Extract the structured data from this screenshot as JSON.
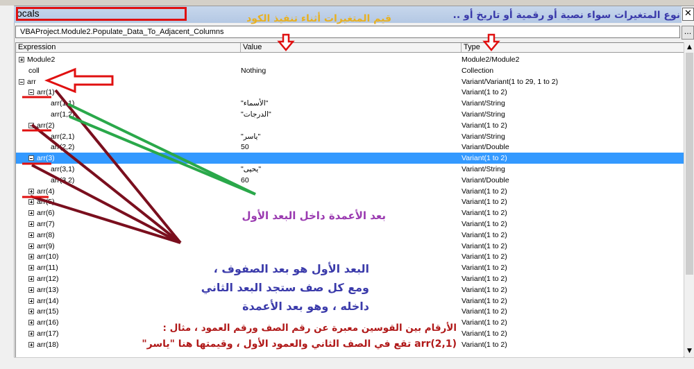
{
  "window": {
    "title": "ocals",
    "close_glyph": "✕"
  },
  "context": {
    "value": "VBAProject.Module2.Populate_Data_To_Adjacent_Columns",
    "button_glyph": "..."
  },
  "columns": {
    "expression": "Expression",
    "value": "Value",
    "type": "Type"
  },
  "rows": [
    {
      "expr": "Module2",
      "val": "",
      "type": "Module2/Module2"
    },
    {
      "expr": "coll",
      "val": "Nothing",
      "type": "Collection"
    },
    {
      "expr": "arr",
      "val": "",
      "type": "Variant/Variant(1 to 29, 1 to 2)"
    },
    {
      "expr": "arr(1)",
      "val": "",
      "type": "Variant(1 to 2)"
    },
    {
      "expr": "arr(1,1)",
      "val": "\"الأسماء\"",
      "type": "Variant/String"
    },
    {
      "expr": "arr(1,2)",
      "val": "\"الدرجات\"",
      "type": "Variant/String"
    },
    {
      "expr": "arr(2)",
      "val": "",
      "type": "Variant(1 to 2)"
    },
    {
      "expr": "arr(2,1)",
      "val": "\"ياسر\"",
      "type": "Variant/String"
    },
    {
      "expr": "arr(2,2)",
      "val": "50",
      "type": "Variant/Double"
    },
    {
      "expr": "arr(3)",
      "val": "",
      "type": "Variant(1 to 2)"
    },
    {
      "expr": "arr(3,1)",
      "val": "\"يحيى\"",
      "type": "Variant/String"
    },
    {
      "expr": "arr(3,2)",
      "val": "60",
      "type": "Variant/Double"
    },
    {
      "expr": "arr(4)",
      "val": "",
      "type": "Variant(1 to 2)"
    },
    {
      "expr": "arr(5)",
      "val": "",
      "type": "Variant(1 to 2)"
    },
    {
      "expr": "arr(6)",
      "val": "",
      "type": "Variant(1 to 2)"
    },
    {
      "expr": "arr(7)",
      "val": "",
      "type": "Variant(1 to 2)"
    },
    {
      "expr": "arr(8)",
      "val": "",
      "type": "Variant(1 to 2)"
    },
    {
      "expr": "arr(9)",
      "val": "",
      "type": "Variant(1 to 2)"
    },
    {
      "expr": "arr(10)",
      "val": "",
      "type": "Variant(1 to 2)"
    },
    {
      "expr": "arr(11)",
      "val": "",
      "type": "Variant(1 to 2)"
    },
    {
      "expr": "arr(12)",
      "val": "",
      "type": "Variant(1 to 2)"
    },
    {
      "expr": "arr(13)",
      "val": "",
      "type": "Variant(1 to 2)"
    },
    {
      "expr": "arr(14)",
      "val": "",
      "type": "Variant(1 to 2)"
    },
    {
      "expr": "arr(15)",
      "val": "",
      "type": "Variant(1 to 2)"
    },
    {
      "expr": "arr(16)",
      "val": "",
      "type": "Variant(1 to 2)"
    },
    {
      "expr": "arr(17)",
      "val": "",
      "type": "Variant(1 to 2)"
    },
    {
      "expr": "arr(18)",
      "val": "",
      "type": "Variant(1 to 2)"
    }
  ],
  "annotations": {
    "header_types": "نوع المتغيرات سواء نصية أو رقمية أو تاريخ أو ..",
    "header_values": "قيم المتغيرات أثناء تنفيذ الكود",
    "columns_dim": "بعد الأعمدة داخل البعد الأول",
    "first_dim_line1": "البعد الأول هو بعد الصفوف ،",
    "first_dim_line2": "ومع كل صف ستجد البعد الثاني",
    "first_dim_line3": "داخله ، وهو بعد الأعمدة",
    "parens_note": "الأرقام بين القوسين معبرة عن رقم الصف ورقم العمود ، مثال :",
    "example_note": "arr(2,1) تقع في الصف الثاني والعمود الأول ، وقيمتها هنا \"ياسر\""
  },
  "colors": {
    "selection": "#3399ff",
    "red": "#e01010",
    "green": "#2aa84a",
    "maroon": "#7a0f1e",
    "blue_text": "#3a3aaa",
    "purple_text": "#9a3ab0"
  }
}
